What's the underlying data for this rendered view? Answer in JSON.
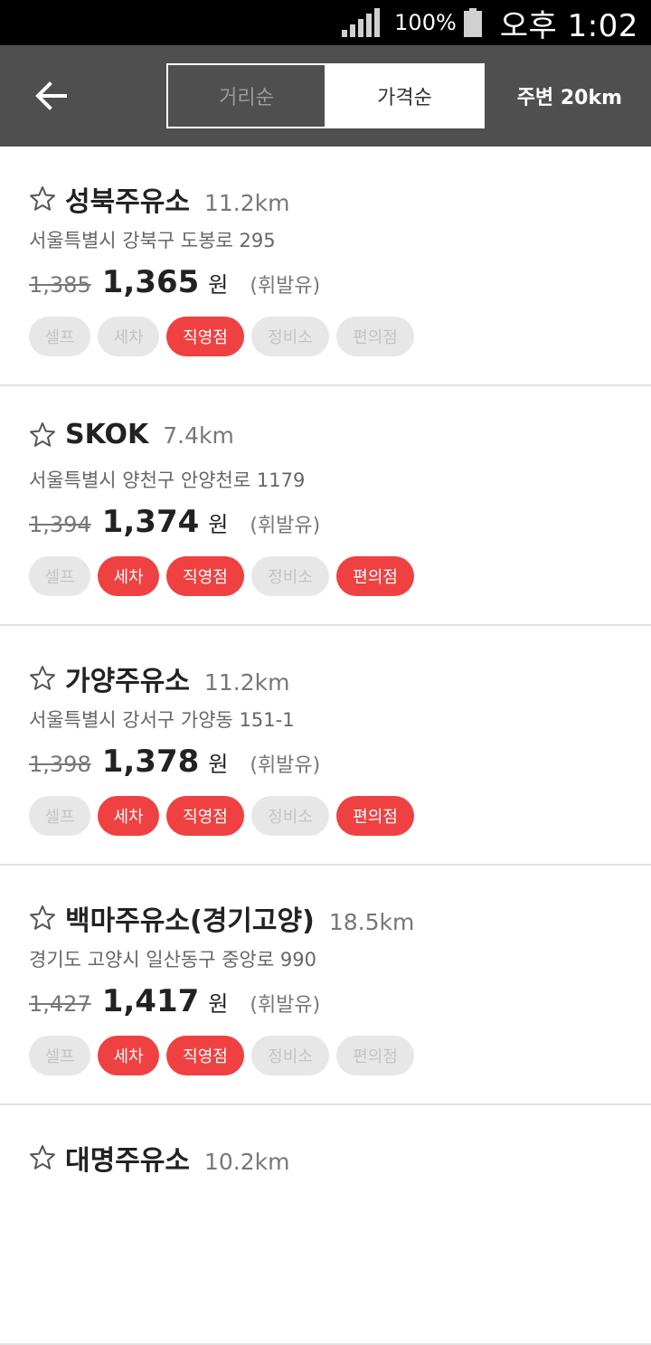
{
  "status_bar": {
    "battery_percent": "100%",
    "time": "오후 1:02"
  },
  "header": {
    "back_icon": "arrow-left-icon",
    "tabs": [
      {
        "label": "거리순",
        "selected": false
      },
      {
        "label": "가격순",
        "selected": true
      }
    ],
    "radius_label": "주변 20km"
  },
  "colors": {
    "header_bg": "#4f4f4f",
    "tag_active": "#ef4141",
    "tag_inactive": "#e7e7e7"
  },
  "stations": [
    {
      "name": "성북주유소",
      "distance": "11.2km",
      "address": "서울특별시 강북구 도봉로 295",
      "old_price": "1,385",
      "price": "1,365",
      "unit": "원",
      "fuel": "(휘발유)",
      "tags": [
        {
          "label": "셀프",
          "active": false
        },
        {
          "label": "세차",
          "active": false
        },
        {
          "label": "직영점",
          "active": true
        },
        {
          "label": "정비소",
          "active": false
        },
        {
          "label": "편의점",
          "active": false
        }
      ]
    },
    {
      "name": "SKOK",
      "distance": "7.4km",
      "address": "서울특별시 양천구 안양천로 1179",
      "old_price": "1,394",
      "price": "1,374",
      "unit": "원",
      "fuel": "(휘발유)",
      "tags": [
        {
          "label": "셀프",
          "active": false
        },
        {
          "label": "세차",
          "active": true
        },
        {
          "label": "직영점",
          "active": true
        },
        {
          "label": "정비소",
          "active": false
        },
        {
          "label": "편의점",
          "active": true
        }
      ]
    },
    {
      "name": "가양주유소",
      "distance": "11.2km",
      "address": "서울특별시 강서구 가양동 151-1",
      "old_price": "1,398",
      "price": "1,378",
      "unit": "원",
      "fuel": "(휘발유)",
      "tags": [
        {
          "label": "셀프",
          "active": false
        },
        {
          "label": "세차",
          "active": true
        },
        {
          "label": "직영점",
          "active": true
        },
        {
          "label": "정비소",
          "active": false
        },
        {
          "label": "편의점",
          "active": true
        }
      ]
    },
    {
      "name": "백마주유소(경기고양)",
      "distance": "18.5km",
      "address": "경기도 고양시 일산동구 중앙로 990",
      "old_price": "1,427",
      "price": "1,417",
      "unit": "원",
      "fuel": "(휘발유)",
      "tags": [
        {
          "label": "셀프",
          "active": false
        },
        {
          "label": "세차",
          "active": true
        },
        {
          "label": "직영점",
          "active": true
        },
        {
          "label": "정비소",
          "active": false
        },
        {
          "label": "편의점",
          "active": false
        }
      ]
    },
    {
      "name": "대명주유소",
      "distance": "10.2km"
    }
  ]
}
